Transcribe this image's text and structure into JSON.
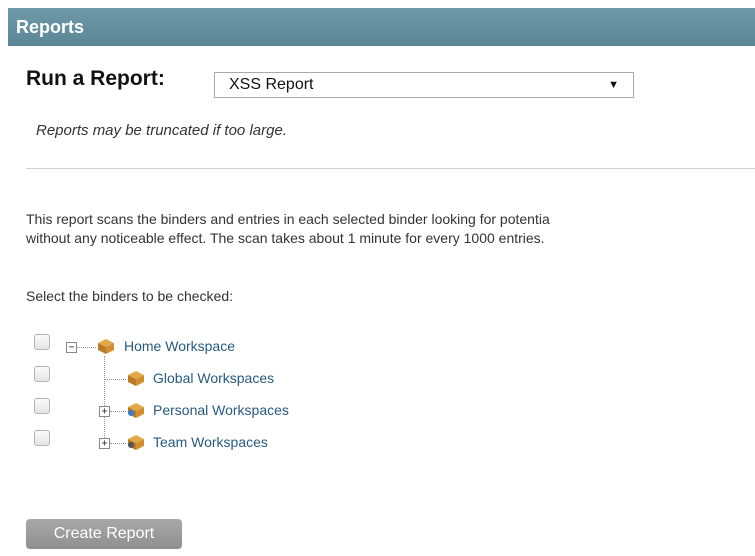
{
  "header": {
    "title": "Reports"
  },
  "run_report": {
    "label": "Run a Report:",
    "selected": "XSS Report",
    "note": "Reports may be truncated if too large."
  },
  "description": {
    "line1": "This report scans the binders and entries in each selected binder looking for potentia",
    "line2": "without any noticeable effect. The scan takes about 1 minute for every 1000 entries."
  },
  "select_label": "Select the binders to be checked:",
  "tree": {
    "root": {
      "label": "Home Workspace",
      "expander": "−"
    },
    "children": [
      {
        "label": "Global Workspaces",
        "expander": ""
      },
      {
        "label": "Personal Workspaces",
        "expander": "+"
      },
      {
        "label": "Team Workspaces",
        "expander": "+"
      }
    ]
  },
  "buttons": {
    "create": "Create Report"
  }
}
